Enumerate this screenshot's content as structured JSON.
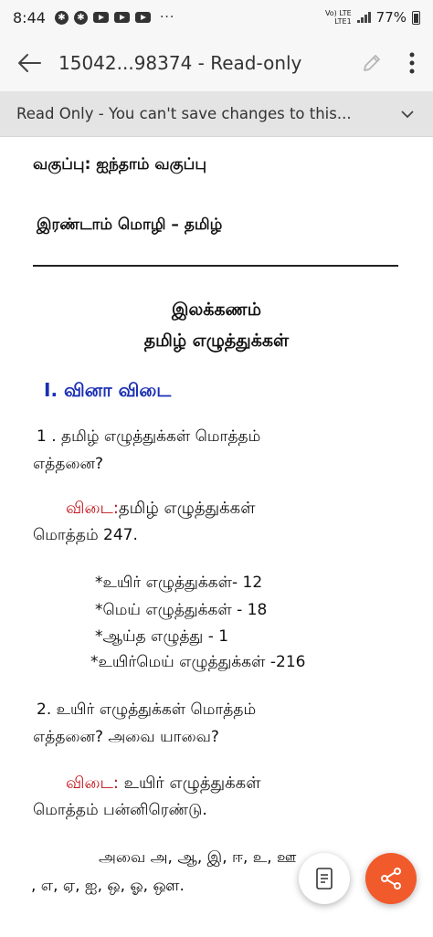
{
  "status_bar": {
    "time": "8:44",
    "network_top": "Vo) LTE",
    "network_bottom": "LTE1",
    "battery": "77%"
  },
  "app_bar": {
    "title": "15042...98374 - Read-only",
    "icons": [
      "back-arrow-icon",
      "pencil-icon",
      "more-vert-icon"
    ]
  },
  "banner": {
    "text": "Read Only - You can't save changes to this..."
  },
  "document": {
    "class_line": "வகுப்பு: ஐந்தாம் வகுப்பு",
    "language_line": "இரண்டாம்  மொழி – தமிழ்",
    "heading_1": "இலக்கணம்",
    "heading_2": "தமிழ் எழுத்துக்கள்",
    "section_title": "I. வினா விடை",
    "q1_line1": "1 . தமிழ் எழுத்துக்கள் மொத்தம்",
    "q1_line2": "எத்தனை?",
    "answer_label_1": "விடை:",
    "a1_line1": "தமிழ் எழுத்துக்கள்",
    "a1_line2": "மொத்தம் 247.",
    "list": [
      "*உயிர் எழுத்துக்கள்- 12",
      "*மெய் எழுத்துக்கள் - 18",
      "*ஆய்த எழுத்து     - 1",
      "*உயிர்மெய் எழுத்துக்கள் -216"
    ],
    "q2_line1": "2.  உயிர் எழுத்துக்கள் மொத்தம்",
    "q2_line2": "எத்தனை? அவை  யாவை?",
    "answer_label_2": "விடை:",
    "a2_line1": " உயிர் எழுத்துக்கள்",
    "a2_line2": "மொத்தம் பன்னிரெண்டு.",
    "letters_line1": "அவை    அ,  ஆ, இ, ஈ, உ,  ஊ",
    "letters_line2": ", எ, ஏ, ஐ, ஒ, ஓ, ஔ."
  },
  "fabs": {
    "document_icon": "document-view-icon",
    "share_icon": "share-icon",
    "share_color": "#f15a2b"
  }
}
